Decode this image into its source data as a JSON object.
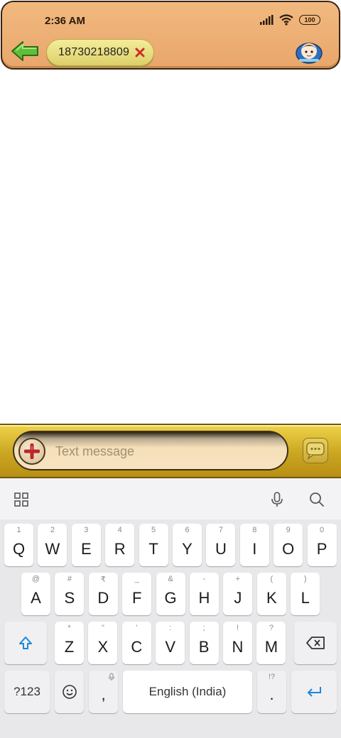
{
  "status_bar": {
    "time": "2:36 AM",
    "battery": "100"
  },
  "header": {
    "recipient": "18730218809"
  },
  "composer": {
    "placeholder": "Text message"
  },
  "keyboard": {
    "row1": [
      {
        "key": "Q",
        "sub": "1"
      },
      {
        "key": "W",
        "sub": "2"
      },
      {
        "key": "E",
        "sub": "3"
      },
      {
        "key": "R",
        "sub": "4"
      },
      {
        "key": "T",
        "sub": "5"
      },
      {
        "key": "Y",
        "sub": "6"
      },
      {
        "key": "U",
        "sub": "7"
      },
      {
        "key": "I",
        "sub": "8"
      },
      {
        "key": "O",
        "sub": "9"
      },
      {
        "key": "P",
        "sub": "0"
      }
    ],
    "row2": [
      {
        "key": "A",
        "sub": "@"
      },
      {
        "key": "S",
        "sub": "#"
      },
      {
        "key": "D",
        "sub": "₹"
      },
      {
        "key": "F",
        "sub": "_"
      },
      {
        "key": "G",
        "sub": "&"
      },
      {
        "key": "H",
        "sub": "-"
      },
      {
        "key": "J",
        "sub": "+"
      },
      {
        "key": "K",
        "sub": "("
      },
      {
        "key": "L",
        "sub": ")"
      }
    ],
    "row3": [
      {
        "key": "Z",
        "sub": "*"
      },
      {
        "key": "X",
        "sub": "\""
      },
      {
        "key": "C",
        "sub": "'"
      },
      {
        "key": "V",
        "sub": ":"
      },
      {
        "key": "B",
        "sub": ";"
      },
      {
        "key": "N",
        "sub": "!"
      },
      {
        "key": "M",
        "sub": "?"
      }
    ],
    "symbols_label": "?123",
    "comma": ",",
    "space_label": "English (India)",
    "period": ".",
    "period_sub": "!?"
  }
}
